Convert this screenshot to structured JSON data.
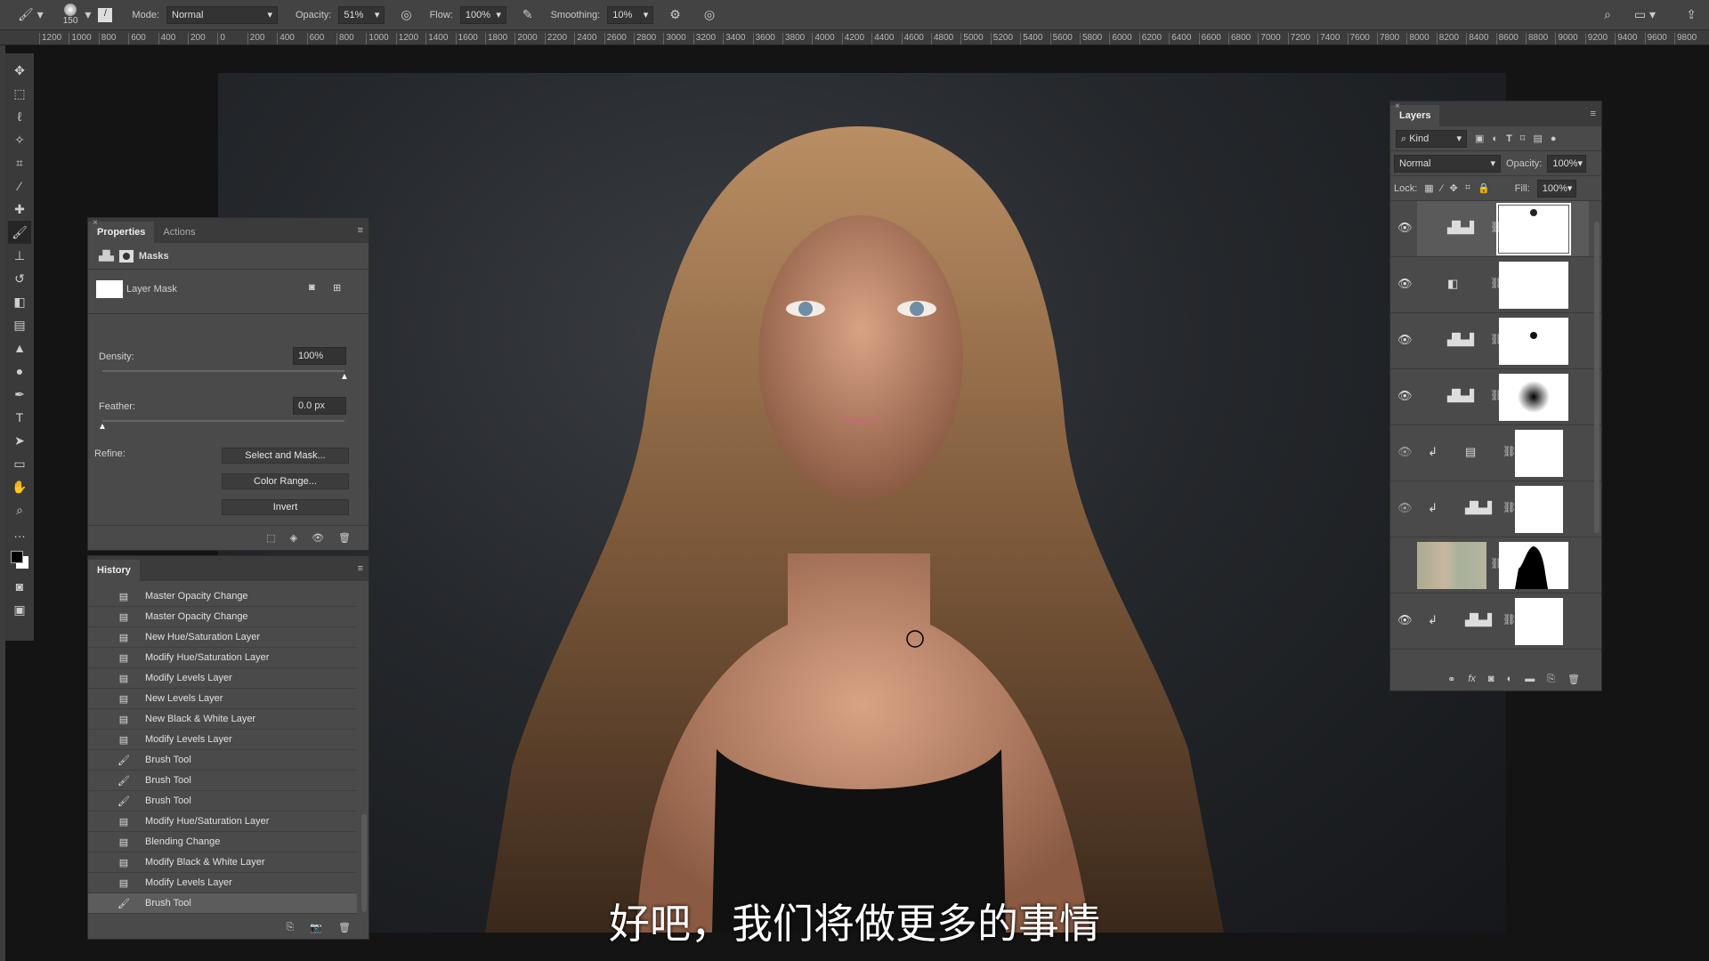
{
  "options_bar": {
    "brush_size": "150",
    "mode_label": "Mode:",
    "mode_value": "Normal",
    "opacity_label": "Opacity:",
    "opacity_value": "51%",
    "flow_label": "Flow:",
    "flow_value": "100%",
    "smoothing_label": "Smoothing:",
    "smoothing_value": "10%"
  },
  "ruler": [
    "1200",
    "1000",
    "800",
    "600",
    "400",
    "200",
    "0",
    "200",
    "400",
    "600",
    "800",
    "1000",
    "1200",
    "1400",
    "1600",
    "1800",
    "2000",
    "2200",
    "2400",
    "2600",
    "2800",
    "3000",
    "3200",
    "3400",
    "3600",
    "3800",
    "4000",
    "4200",
    "4400",
    "4600",
    "4800",
    "5000",
    "5200",
    "5400",
    "5600",
    "5800",
    "6000",
    "6200",
    "6400",
    "6600",
    "6800",
    "7000",
    "7200",
    "7400",
    "7600",
    "7800",
    "8000",
    "8200",
    "8400",
    "8600",
    "8800",
    "9000",
    "9200",
    "9400",
    "9600",
    "9800"
  ],
  "properties": {
    "tabs": [
      "Properties",
      "Actions"
    ],
    "section": "Masks",
    "mask_name": "Layer Mask",
    "density_label": "Density:",
    "density_value": "100%",
    "density": 100,
    "feather_label": "Feather:",
    "feather_value": "0.0 px",
    "feather": 0,
    "refine_label": "Refine:",
    "buttons": [
      "Select and Mask...",
      "Color Range...",
      "Invert"
    ]
  },
  "history": {
    "title": "History",
    "items": [
      {
        "label": "Master Opacity Change",
        "icon": "document"
      },
      {
        "label": "Master Opacity Change",
        "icon": "document"
      },
      {
        "label": "New Hue/Saturation Layer",
        "icon": "document"
      },
      {
        "label": "Modify Hue/Saturation Layer",
        "icon": "document"
      },
      {
        "label": "Modify Levels Layer",
        "icon": "document"
      },
      {
        "label": "New Levels Layer",
        "icon": "document"
      },
      {
        "label": "New Black & White Layer",
        "icon": "document"
      },
      {
        "label": "Modify Levels Layer",
        "icon": "document"
      },
      {
        "label": "Brush Tool",
        "icon": "brush"
      },
      {
        "label": "Brush Tool",
        "icon": "brush"
      },
      {
        "label": "Brush Tool",
        "icon": "brush"
      },
      {
        "label": "Modify Hue/Saturation Layer",
        "icon": "document"
      },
      {
        "label": "Blending Change",
        "icon": "document"
      },
      {
        "label": "Modify Black & White Layer",
        "icon": "document"
      },
      {
        "label": "Modify Levels Layer",
        "icon": "document"
      },
      {
        "label": "Brush Tool",
        "icon": "brush",
        "selected": true
      }
    ]
  },
  "layers": {
    "title": "Layers",
    "filter": "Kind",
    "blend": "Normal",
    "opacity_label": "Opacity:",
    "opacity": "100%",
    "lock_label": "Lock:",
    "fill_label": "Fill:",
    "fill": "100%",
    "items": [
      {
        "type": "levels",
        "visible": true,
        "clipped": false,
        "mask": "dot-top",
        "selected": true
      },
      {
        "type": "black-white",
        "visible": true,
        "clipped": false,
        "mask": "white"
      },
      {
        "type": "levels",
        "visible": true,
        "clipped": false,
        "mask": "dot"
      },
      {
        "type": "levels",
        "visible": true,
        "clipped": false,
        "mask": "soft-dot"
      },
      {
        "type": "gradient-map",
        "visible": true,
        "dim": true,
        "clipped": true,
        "mask": "white"
      },
      {
        "type": "levels",
        "visible": true,
        "dim": true,
        "clipped": true,
        "mask": "white"
      },
      {
        "type": "texture",
        "visible": false,
        "clipped": false,
        "mask": "silhouette"
      },
      {
        "type": "levels",
        "visible": true,
        "clipped": true,
        "mask": "white"
      }
    ]
  },
  "subtitle": "好吧，我们将做更多的事情"
}
